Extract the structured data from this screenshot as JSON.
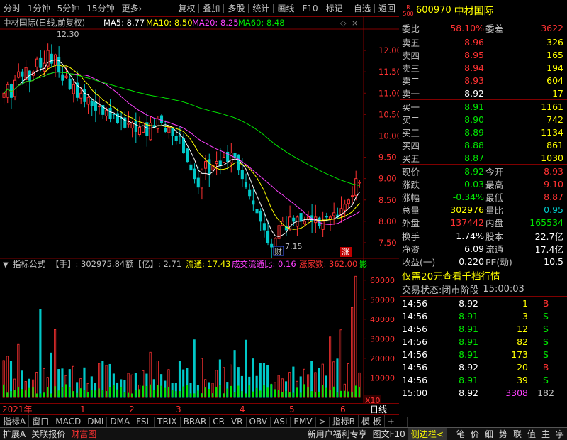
{
  "toolbar": {
    "left": [
      "分时",
      "1分钟",
      "5分钟",
      "15分钟",
      "更多›"
    ],
    "right": [
      "复权",
      "叠加",
      "多股",
      "统计",
      "画线",
      "F10",
      "标记",
      "-自选",
      "返回"
    ]
  },
  "chart_header": {
    "title": "中材国际(日线,前复权)",
    "ma5": "MA5: 8.77",
    "ma10": "MA10: 8.50",
    "ma20": "MA20: 8.25",
    "ma60": "MA60: 8.48"
  },
  "price_axis": [
    "12.00",
    "11.50",
    "11.00",
    "10.50",
    "10.00",
    "9.50",
    "9.00",
    "8.50",
    "8.00",
    "7.50"
  ],
  "annotations": {
    "high": "12.30",
    "low": "7.15",
    "cai": "财",
    "zhang": "涨"
  },
  "volume_header": {
    "name": "指标公式",
    "shou": "【手】: 302975.84",
    "e": "额【亿】: 2.71",
    "liutong": "流通: 17.43",
    "ratio": "成交流通比: 0.16",
    "zhangjia": "涨家数: 362.00",
    "r": "影"
  },
  "volume_axis": [
    "60000",
    "50000",
    "40000",
    "30000",
    "20000",
    "10000",
    "X10"
  ],
  "date_axis": [
    "2021年",
    "1",
    "2",
    "3",
    "4",
    "5",
    "6",
    "日线"
  ],
  "indicator_tabs": [
    "指标A",
    "窗口",
    "MACD",
    "DMI",
    "DMA",
    "FSL",
    "TRIX",
    "BRAR",
    "CR",
    "VR",
    "OBV",
    "ASI",
    "EMV",
    ">",
    "指标B",
    "模 板",
    "+",
    "-"
  ],
  "bottom_bar": {
    "left": [
      "扩展A",
      "关联报价",
      "财富图"
    ],
    "mid": [
      "新用户福利专享",
      "图文F10",
      "侧边栏<"
    ],
    "right": [
      "笔",
      "价",
      "细",
      "势",
      "联",
      "值",
      "主",
      "字"
    ]
  },
  "colors": {
    "up": "#ff3232",
    "down": "#00e600",
    "ma5": "#ffffff",
    "ma10": "#ffff00",
    "ma20": "#ff40ff",
    "ma60": "#00e600",
    "frame": "#800000"
  },
  "stock": {
    "badge_top": "R",
    "badge_bot": "500",
    "code": "600970",
    "name": "中材国际"
  },
  "weibi": {
    "l1": "委比",
    "v1": "58.10%",
    "l2": "委差",
    "v2": "3622"
  },
  "asks": [
    {
      "label": "卖五",
      "price": "8.96",
      "vol": "326"
    },
    {
      "label": "卖四",
      "price": "8.95",
      "vol": "165"
    },
    {
      "label": "卖三",
      "price": "8.94",
      "vol": "194"
    },
    {
      "label": "卖二",
      "price": "8.93",
      "vol": "604"
    },
    {
      "label": "卖一",
      "price": "8.92",
      "vol": "17"
    }
  ],
  "bids": [
    {
      "label": "买一",
      "price": "8.91",
      "vol": "1161"
    },
    {
      "label": "买二",
      "price": "8.90",
      "vol": "742"
    },
    {
      "label": "买三",
      "price": "8.89",
      "vol": "1134"
    },
    {
      "label": "买四",
      "price": "8.88",
      "vol": "861"
    },
    {
      "label": "买五",
      "price": "8.87",
      "vol": "1030"
    }
  ],
  "quote": [
    {
      "l1": "现价",
      "v1": "8.92",
      "l2": "今开",
      "v2": "8.93"
    },
    {
      "l1": "涨跌",
      "v1": "-0.03",
      "l2": "最高",
      "v2": "9.10"
    },
    {
      "l1": "涨幅",
      "v1": "-0.34%",
      "l2": "最低",
      "v2": "8.87"
    },
    {
      "l1": "总量",
      "v1": "302976",
      "l2": "量比",
      "v2": "0.95"
    },
    {
      "l1": "外盘",
      "v1": "137442",
      "l2": "内盘",
      "v2": "165534"
    }
  ],
  "quote2": [
    {
      "l1": "换手",
      "v1": "1.74%",
      "l2": "股本",
      "v2": "22.7亿"
    },
    {
      "l1": "净资",
      "v1": "6.09",
      "l2": "流通",
      "v2": "17.4亿"
    },
    {
      "l1": "收益(一)",
      "v1": "0.220",
      "l2": "PE(动)",
      "v2": "10.5"
    }
  ],
  "promo": "仅需20元查看千档行情",
  "trade_status": {
    "label": "交易状态:",
    "value": "闭市阶段",
    "time": "15:00:03"
  },
  "ticks": [
    {
      "t": "14:56",
      "p": "8.92",
      "v": "1",
      "d": "B"
    },
    {
      "t": "14:56",
      "p": "8.91",
      "v": "3",
      "d": "S"
    },
    {
      "t": "14:56",
      "p": "8.91",
      "v": "12",
      "d": "S"
    },
    {
      "t": "14:56",
      "p": "8.91",
      "v": "82",
      "d": "S"
    },
    {
      "t": "14:56",
      "p": "8.91",
      "v": "173",
      "d": "S"
    },
    {
      "t": "14:56",
      "p": "8.92",
      "v": "20",
      "d": "B"
    },
    {
      "t": "14:56",
      "p": "8.91",
      "v": "39",
      "d": "S"
    },
    {
      "t": "15:00",
      "p": "8.92",
      "v": "3308",
      "d": "182"
    }
  ],
  "chart_data": {
    "type": "candlestick",
    "ylim": [
      7.2,
      12.5
    ],
    "ma_values": {
      "ma5": 8.77,
      "ma10": 8.5,
      "ma20": 8.25,
      "ma60": 8.48
    },
    "volume_ylim": [
      0,
      65000
    ],
    "closes": [
      11.0,
      11.2,
      10.9,
      11.3,
      11.5,
      11.4,
      11.6,
      11.3,
      11.5,
      11.8,
      11.6,
      11.7,
      12.0,
      11.7,
      11.9,
      11.5,
      11.3,
      11.4,
      11.1,
      11.2,
      10.9,
      11.0,
      10.8,
      10.9,
      10.7,
      10.6,
      10.7,
      10.5,
      10.6,
      10.4,
      10.5,
      10.3,
      10.4,
      10.2,
      10.3,
      10.3,
      10.1,
      10.2,
      10.3,
      10.0,
      10.3,
      10.2,
      10.4,
      10.3,
      10.1,
      10.2,
      10.0,
      9.9,
      10.0,
      9.6,
      9.4,
      9.2,
      9.0,
      8.8,
      9.2,
      9.4,
      9.1,
      9.3,
      9.4,
      9.3,
      9.5,
      9.4,
      9.6,
      9.5,
      9.2,
      9.0,
      8.8,
      8.6,
      8.4,
      8.2,
      8.0,
      7.8,
      7.5,
      7.4,
      7.6,
      7.9,
      8.0,
      7.8,
      8.1,
      8.0,
      8.1,
      8.0,
      8.0,
      8.1,
      8.0,
      8.1,
      7.9,
      8.0,
      8.1,
      8.1,
      8.2,
      8.1,
      8.3,
      8.4,
      8.5,
      8.6,
      9.0,
      8.92
    ]
  }
}
